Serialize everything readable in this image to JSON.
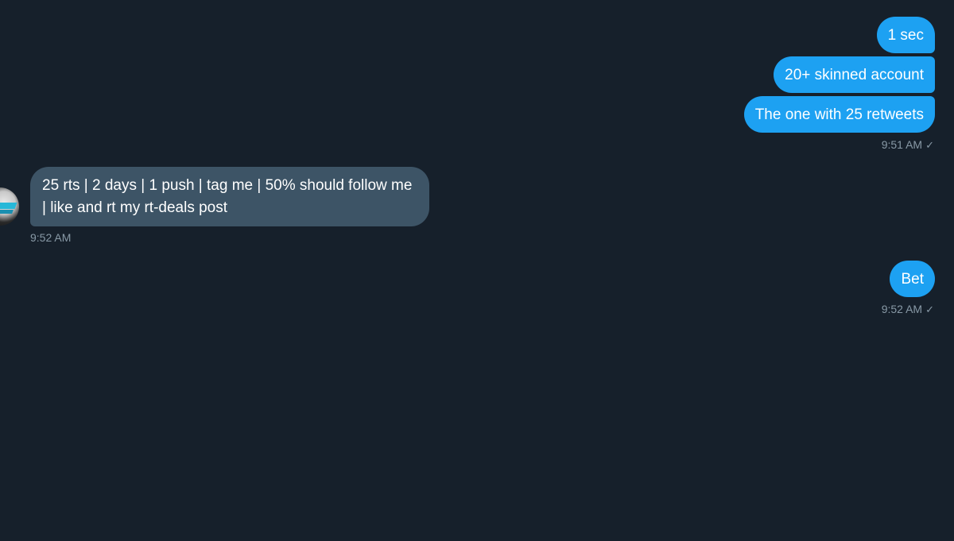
{
  "messages": [
    {
      "direction": "sent",
      "text": "1 sec"
    },
    {
      "direction": "sent",
      "text": "20+ skinned account"
    },
    {
      "direction": "sent",
      "text": "The one with 25 retweets"
    },
    {
      "direction": "received",
      "text": "25 rts | 2 days | 1 push | tag me | 50% should follow me | like and rt my rt-deals post"
    },
    {
      "direction": "sent",
      "text": "Bet"
    }
  ],
  "timestamps": {
    "group1": "9:51 AM",
    "received": "9:52 AM",
    "group2": "9:52 AM"
  },
  "read_check": "✓",
  "colors": {
    "background": "#16202b",
    "sent_bubble": "#1da1f2",
    "received_bubble": "#3d5466",
    "meta_text": "#8899a6"
  },
  "icons": {
    "avatar": "user-avatar",
    "check": "sent-check-icon"
  }
}
